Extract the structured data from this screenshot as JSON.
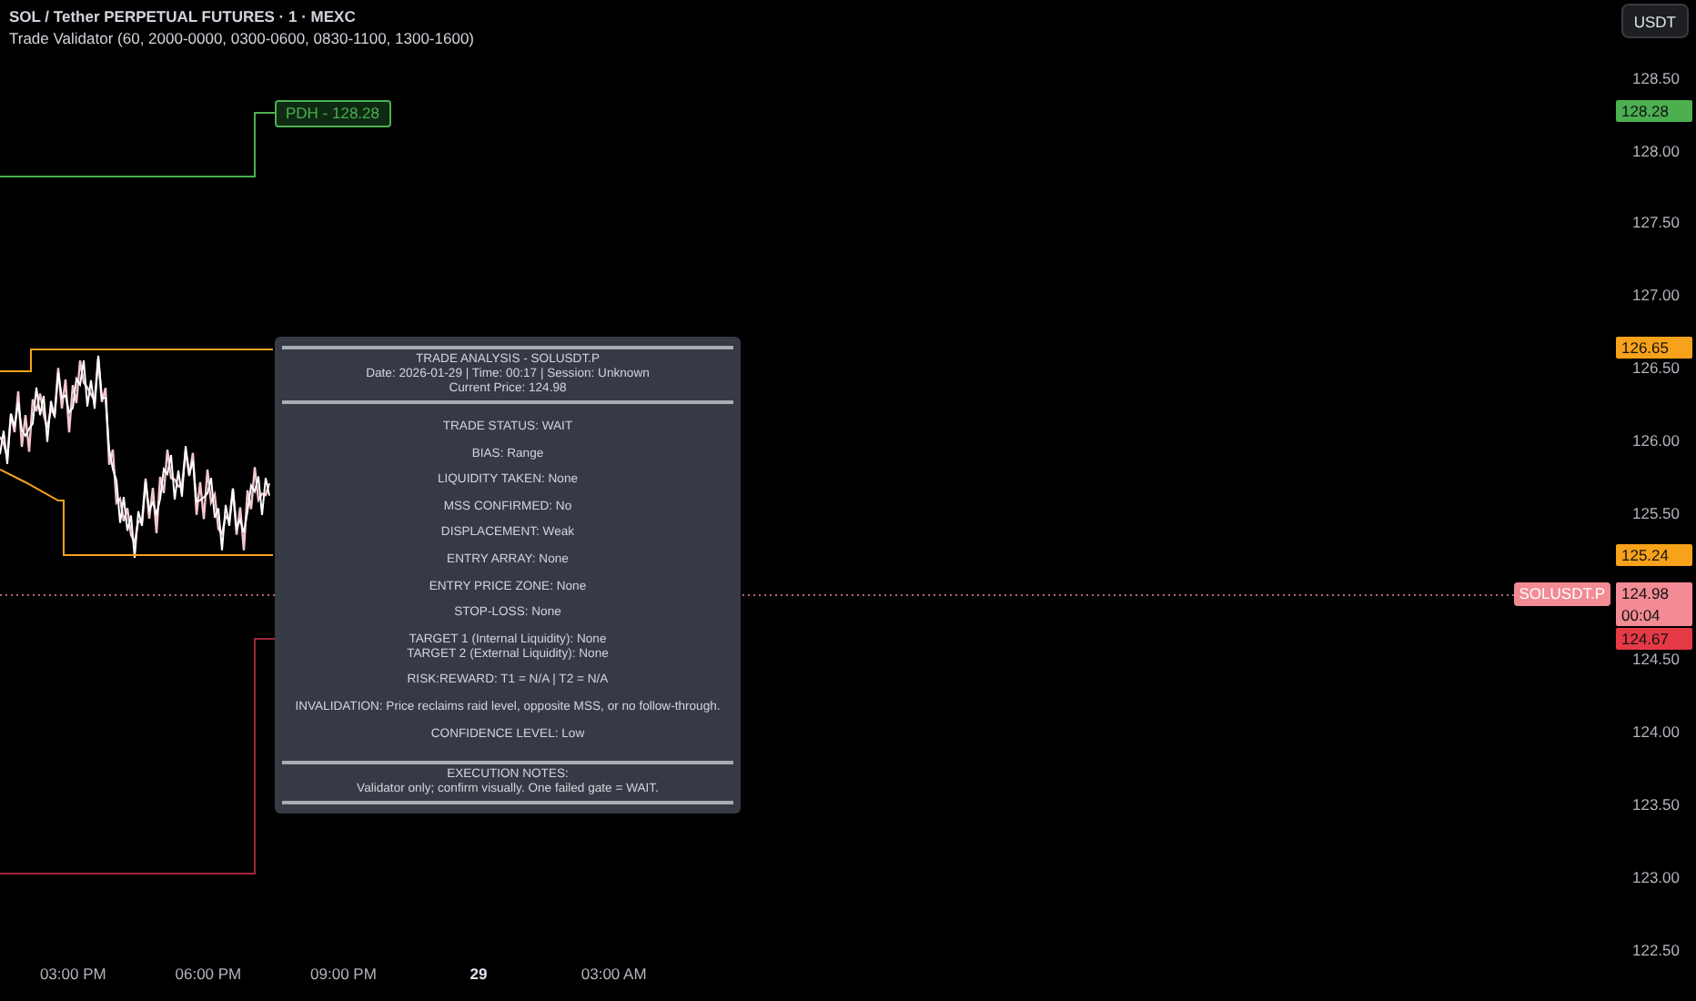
{
  "header": {
    "symbol_title": "SOL / Tether PERPETUAL FUTURES · 1 · MEXC",
    "indicator": "Trade Validator (60, 2000-0000, 0300-0600, 0830-1100, 1300-1600)"
  },
  "currency_button": "USDT",
  "chart_labels": [
    {
      "text": "PDH - 128.28",
      "color": "#4caf50"
    }
  ],
  "price_axis": {
    "ticks": [
      "128.50",
      "128.00",
      "127.50",
      "127.00",
      "126.50",
      "126.00",
      "125.50",
      "124.50",
      "124.00",
      "123.50",
      "123.00",
      "122.50"
    ],
    "badges": [
      {
        "text": "128.28",
        "color": "#4caf50"
      },
      {
        "text": "126.65",
        "color": "#f7a21b"
      },
      {
        "text": "125.24",
        "color": "#f7a21b"
      },
      {
        "text": "124.98",
        "countdown": "00:04",
        "symbol": "SOLUSDT.P",
        "color": "#f28b94"
      },
      {
        "text": "124.67",
        "color": "#e53946"
      }
    ]
  },
  "time_axis": [
    {
      "label": "03:00 PM",
      "kind": "time"
    },
    {
      "label": "06:00 PM",
      "kind": "time"
    },
    {
      "label": "09:00 PM",
      "kind": "time"
    },
    {
      "label": "29",
      "kind": "day"
    },
    {
      "label": "03:00 AM",
      "kind": "time"
    }
  ],
  "analysis_panel": {
    "title": "TRADE ANALYSIS - SOLUSDT.P",
    "meta": "Date: 2026-01-29 | Time: 00:17 | Session: Unknown",
    "current_price": "Current Price: 124.98",
    "groups": [
      [
        "TRADE STATUS: WAIT"
      ],
      [
        "BIAS: Range"
      ],
      [
        "LIQUIDITY TAKEN: None"
      ],
      [
        "MSS CONFIRMED: No"
      ],
      [
        "DISPLACEMENT: Weak"
      ],
      [
        "ENTRY ARRAY: None"
      ],
      [
        "ENTRY PRICE ZONE: None"
      ],
      [
        "STOP-LOSS: None"
      ],
      [
        "TARGET 1 (Internal Liquidity): None",
        "TARGET 2 (External Liquidity): None"
      ],
      [
        "RISK:REWARD: T1 = N/A | T2 = N/A"
      ],
      [
        "INVALIDATION: Price reclaims raid level, opposite MSS, or no follow-through."
      ],
      [
        "CONFIDENCE LEVEL: Low"
      ]
    ],
    "notes_title": "EXECUTION NOTES:",
    "notes": "Validator only; confirm visually. One failed gate = WAIT."
  }
}
